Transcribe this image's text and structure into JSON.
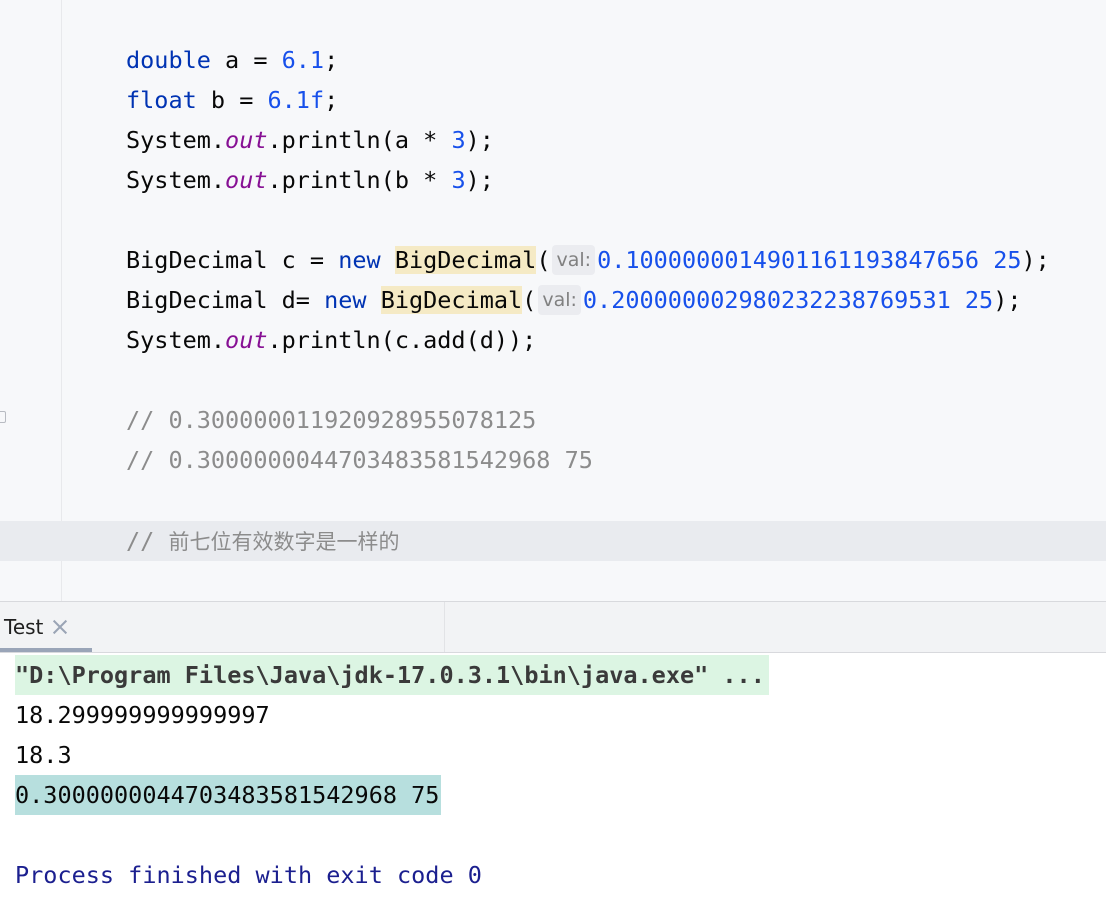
{
  "editor": {
    "line1": {
      "type": "double",
      "name": " a = ",
      "value": "6.1",
      "end": ";"
    },
    "line2": {
      "type": "float",
      "name": " b = ",
      "value": "6.1f",
      "end": ";"
    },
    "line3": {
      "cls": "System.",
      "field": "out",
      "call": ".println(a * ",
      "arg": "3",
      "end": ");"
    },
    "line4": {
      "cls": "System.",
      "field": "out",
      "call": ".println(b * ",
      "arg": "3",
      "end": ");"
    },
    "line5": {
      "type": "BigDecimal",
      "name": " c = ",
      "kw": "new",
      "ctor": "BigDecimal",
      "open": "(",
      "hint": "val:",
      "value": "0.1000000014901161193847656 25",
      "end": ");"
    },
    "line6": {
      "type": "BigDecimal",
      "name": " d= ",
      "kw": "new",
      "ctor": "BigDecimal",
      "open": "(",
      "hint": "val:",
      "value": "0.200000002980232238769531 25",
      "end": ");"
    },
    "line7": {
      "cls": "System.",
      "field": "out",
      "call": ".println(c.add(d));"
    },
    "comment1": "// 0.300000011920928955078125",
    "comment2": "// 0.3000000044703483581542968 75",
    "comment3_prefix": "// ",
    "comment3_text": "前七位有效数字是一样的"
  },
  "run_panel": {
    "tab_label": "Test",
    "output": {
      "command": "\"D:\\Program Files\\Java\\jdk-17.0.3.1\\bin\\java.exe\" ...",
      "line1": "18.299999999999997",
      "line2": "18.3",
      "line3": "0.3000000044703483581542968 75",
      "exit": "Process finished with exit code 0"
    }
  },
  "colors": {
    "keyword": "#0033b3",
    "number": "#1750eb",
    "field": "#871094",
    "comment": "#8c8c8c",
    "class_highlight": "#f5eac5",
    "command_bg": "#dcf5e3",
    "result_bg": "#b7dfde",
    "process_text": "#1b1f8f"
  }
}
